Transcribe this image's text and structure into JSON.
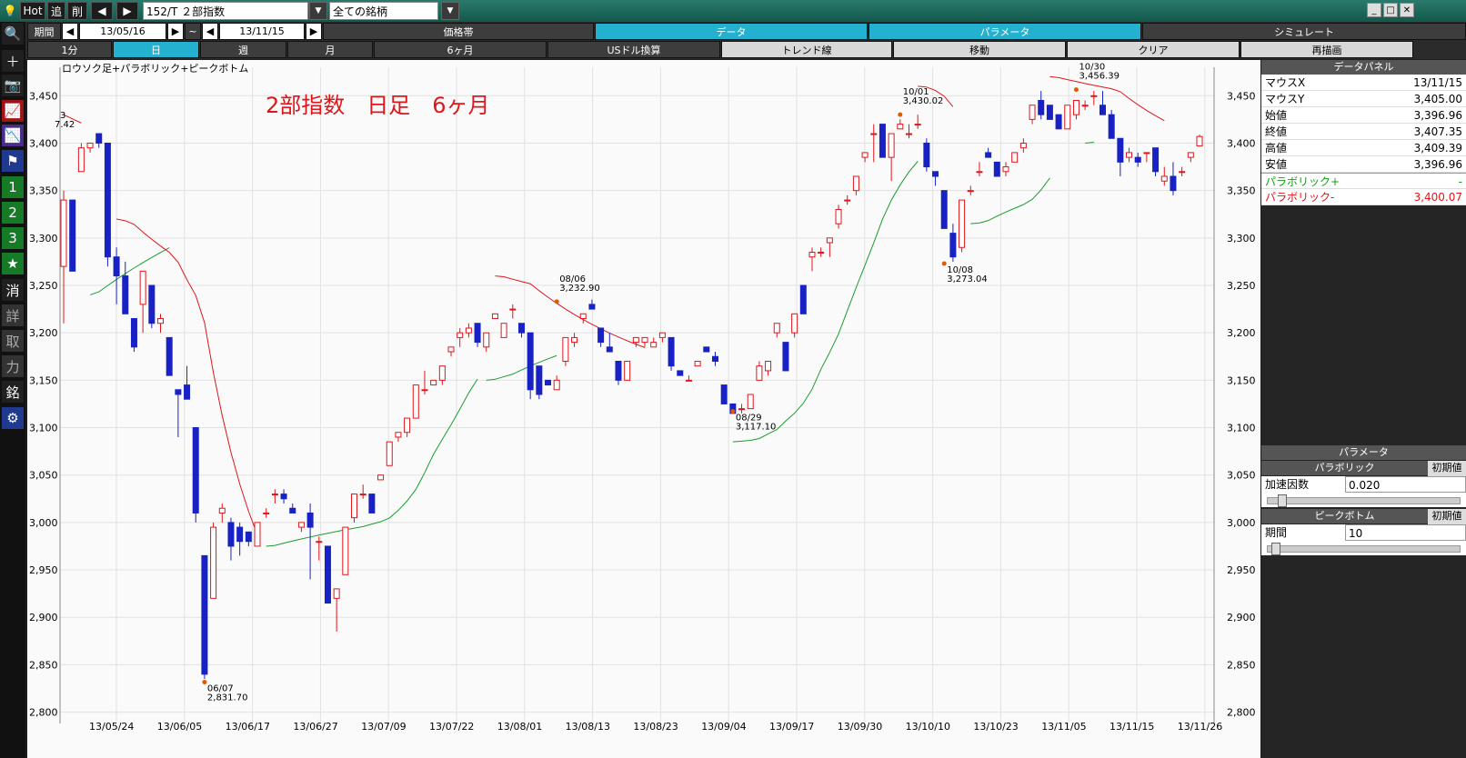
{
  "toolbar": {
    "hot": "Hot",
    "add": "追",
    "del": "削",
    "code": "152/T ２部指数",
    "filter": "全ての銘柄"
  },
  "period_row": {
    "label": "期間",
    "start": "13/05/16",
    "tilde": "~",
    "end": "13/11/15",
    "tabs": [
      "価格帯",
      "データ",
      "パラメータ",
      "シミュレート"
    ]
  },
  "timeframe_row": {
    "items": [
      "1分",
      "日",
      "週",
      "月",
      "6ヶ月",
      "USドル換算",
      "トレンド線",
      "移動",
      "クリア",
      "再描画"
    ]
  },
  "sidebar": {
    "items": [
      "search",
      "plus",
      "camera",
      "chart1",
      "chart2",
      "flag",
      "1",
      "2",
      "3",
      "★",
      "消",
      "詳",
      "取",
      "力",
      "銘",
      "gear"
    ]
  },
  "chart": {
    "indicator_label": "ロウソク足+パラボリック+ピークボトム",
    "title": "2部指数　日足　6ヶ月",
    "peak_labels": [
      {
        "date": "06/07",
        "value": "2,831.70"
      },
      {
        "date": "08/06",
        "value": "3,232.90"
      },
      {
        "date": "08/29",
        "value": "3,117.10"
      },
      {
        "date": "10/01",
        "value": "3,430.02"
      },
      {
        "date": "10/08",
        "value": "3,273.04"
      },
      {
        "date": "10/30",
        "value": "3,456.39"
      }
    ],
    "left_partial": [
      "3",
      "7.42"
    ]
  },
  "chart_data": {
    "type": "candlestick",
    "y_ticks": [
      "3,450",
      "3,400",
      "3,350",
      "3,300",
      "3,250",
      "3,200",
      "3,150",
      "3,100",
      "3,050",
      "3,000",
      "2,950",
      "2,900",
      "2,850",
      "2,800"
    ],
    "ylim": [
      2790,
      3480
    ],
    "x_ticks": [
      "13/05/24",
      "13/06/05",
      "13/06/17",
      "13/06/27",
      "13/07/09",
      "13/07/22",
      "13/08/01",
      "13/08/13",
      "13/08/23",
      "13/09/04",
      "13/09/17",
      "13/09/30",
      "13/10/10",
      "13/10/23",
      "13/11/05",
      "13/11/15",
      "13/11/26"
    ],
    "candles": [
      [
        3270,
        3350,
        3210,
        3340
      ],
      [
        3340,
        3340,
        3265,
        3265
      ],
      [
        3370,
        3400,
        3370,
        3395
      ],
      [
        3395,
        3400,
        3390,
        3400
      ],
      [
        3410,
        3410,
        3395,
        3400
      ],
      [
        3400,
        3400,
        3270,
        3280
      ],
      [
        3280,
        3290,
        3230,
        3260
      ],
      [
        3260,
        3275,
        3220,
        3220
      ],
      [
        3215,
        3215,
        3180,
        3185
      ],
      [
        3230,
        3265,
        3200,
        3265
      ],
      [
        3250,
        3250,
        3205,
        3210
      ],
      [
        3210,
        3220,
        3200,
        3215
      ],
      [
        3195,
        3195,
        3155,
        3155
      ],
      [
        3140,
        3140,
        3090,
        3135
      ],
      [
        3145,
        3165,
        3130,
        3130
      ],
      [
        3100,
        3100,
        3000,
        3010
      ],
      [
        2965,
        2965,
        2835,
        2840
      ],
      [
        2920,
        3000,
        2920,
        2995
      ],
      [
        3010,
        3020,
        3000,
        3015
      ],
      [
        3000,
        3005,
        2960,
        2975
      ],
      [
        2995,
        3000,
        2965,
        2980
      ],
      [
        2990,
        2990,
        2975,
        2980
      ],
      [
        2975,
        3000,
        2975,
        3000
      ],
      [
        3010,
        3015,
        3005,
        3010
      ],
      [
        3030,
        3035,
        3020,
        3030
      ],
      [
        3030,
        3035,
        3020,
        3025
      ],
      [
        3015,
        3020,
        3010,
        3010
      ],
      [
        2995,
        3000,
        2990,
        3000
      ],
      [
        3010,
        3020,
        2940,
        2995
      ],
      [
        2980,
        2985,
        2960,
        2980
      ],
      [
        2975,
        2975,
        2915,
        2915
      ],
      [
        2920,
        2930,
        2885,
        2930
      ],
      [
        2945,
        2995,
        2945,
        2995
      ],
      [
        3005,
        3020,
        3000,
        3030
      ],
      [
        3030,
        3040,
        3025,
        3030
      ],
      [
        3030,
        3030,
        3010,
        3010
      ],
      [
        3045,
        3050,
        3045,
        3050
      ],
      [
        3060,
        3085,
        3060,
        3085
      ],
      [
        3090,
        3095,
        3085,
        3095
      ],
      [
        3095,
        3110,
        3090,
        3110
      ],
      [
        3110,
        3145,
        3110,
        3145
      ],
      [
        3140,
        3160,
        3135,
        3140
      ],
      [
        3145,
        3150,
        3145,
        3150
      ],
      [
        3150,
        3165,
        3145,
        3165
      ],
      [
        3180,
        3185,
        3175,
        3185
      ],
      [
        3195,
        3205,
        3185,
        3200
      ],
      [
        3200,
        3210,
        3195,
        3205
      ],
      [
        3210,
        3210,
        3185,
        3190
      ],
      [
        3185,
        3200,
        3180,
        3200
      ],
      [
        3215,
        3220,
        3215,
        3220
      ],
      [
        3195,
        3210,
        3195,
        3210
      ],
      [
        3225,
        3230,
        3215,
        3225
      ],
      [
        3210,
        3210,
        3195,
        3200
      ],
      [
        3200,
        3195,
        3130,
        3140
      ],
      [
        3165,
        3165,
        3130,
        3135
      ],
      [
        3150,
        3150,
        3145,
        3145
      ],
      [
        3140,
        3155,
        3140,
        3150
      ],
      [
        3170,
        3195,
        3165,
        3195
      ],
      [
        3190,
        3200,
        3185,
        3195
      ],
      [
        3215,
        3220,
        3210,
        3220
      ],
      [
        3230,
        3235,
        3225,
        3225
      ],
      [
        3205,
        3205,
        3185,
        3190
      ],
      [
        3185,
        3200,
        3180,
        3180
      ],
      [
        3170,
        3170,
        3145,
        3150
      ],
      [
        3150,
        3170,
        3150,
        3170
      ],
      [
        3190,
        3195,
        3185,
        3195
      ],
      [
        3190,
        3195,
        3185,
        3195
      ],
      [
        3185,
        3195,
        3185,
        3190
      ],
      [
        3195,
        3200,
        3190,
        3200
      ],
      [
        3195,
        3195,
        3160,
        3165
      ],
      [
        3160,
        3160,
        3155,
        3155
      ],
      [
        3150,
        3155,
        3150,
        3150
      ],
      [
        3165,
        3170,
        3165,
        3170
      ],
      [
        3185,
        3185,
        3180,
        3180
      ],
      [
        3175,
        3180,
        3165,
        3170
      ],
      [
        3145,
        3145,
        3125,
        3125
      ],
      [
        3125,
        3125,
        3115,
        3115
      ],
      [
        3120,
        3125,
        3115,
        3120
      ],
      [
        3120,
        3135,
        3120,
        3135
      ],
      [
        3150,
        3170,
        3150,
        3165
      ],
      [
        3160,
        3170,
        3155,
        3170
      ],
      [
        3200,
        3210,
        3195,
        3210
      ],
      [
        3190,
        3190,
        3160,
        3160
      ],
      [
        3200,
        3220,
        3195,
        3220
      ],
      [
        3250,
        3250,
        3220,
        3220
      ],
      [
        3280,
        3290,
        3265,
        3285
      ],
      [
        3285,
        3290,
        3280,
        3285
      ],
      [
        3295,
        3300,
        3280,
        3300
      ],
      [
        3315,
        3335,
        3310,
        3330
      ],
      [
        3340,
        3345,
        3335,
        3340
      ],
      [
        3350,
        3365,
        3345,
        3365
      ],
      [
        3385,
        3390,
        3380,
        3390
      ],
      [
        3410,
        3420,
        3380,
        3410
      ],
      [
        3420,
        3420,
        3385,
        3385
      ],
      [
        3385,
        3410,
        3360,
        3410
      ],
      [
        3415,
        3425,
        3415,
        3420
      ],
      [
        3410,
        3420,
        3405,
        3410
      ],
      [
        3420,
        3430,
        3415,
        3420
      ],
      [
        3400,
        3405,
        3370,
        3375
      ],
      [
        3370,
        3370,
        3355,
        3365
      ],
      [
        3350,
        3350,
        3310,
        3310
      ],
      [
        3305,
        3315,
        3275,
        3280
      ],
      [
        3290,
        3340,
        3285,
        3340
      ],
      [
        3350,
        3355,
        3345,
        3350
      ],
      [
        3370,
        3380,
        3365,
        3370
      ],
      [
        3390,
        3395,
        3385,
        3385
      ],
      [
        3380,
        3380,
        3365,
        3365
      ],
      [
        3370,
        3380,
        3365,
        3375
      ],
      [
        3380,
        3390,
        3380,
        3390
      ],
      [
        3395,
        3405,
        3390,
        3400
      ],
      [
        3425,
        3440,
        3420,
        3440
      ],
      [
        3445,
        3455,
        3425,
        3430
      ],
      [
        3440,
        3440,
        3425,
        3425
      ],
      [
        3430,
        3430,
        3415,
        3415
      ],
      [
        3415,
        3440,
        3415,
        3440
      ],
      [
        3430,
        3445,
        3425,
        3445
      ],
      [
        3440,
        3445,
        3435,
        3440
      ],
      [
        3450,
        3455,
        3440,
        3450
      ],
      [
        3440,
        3455,
        3430,
        3430
      ],
      [
        3430,
        3435,
        3405,
        3405
      ],
      [
        3405,
        3405,
        3365,
        3380
      ],
      [
        3385,
        3395,
        3380,
        3390
      ],
      [
        3385,
        3390,
        3375,
        3380
      ],
      [
        3390,
        3390,
        3380,
        3390
      ],
      [
        3395,
        3395,
        3365,
        3370
      ],
      [
        3360,
        3375,
        3355,
        3365
      ],
      [
        3365,
        3380,
        3345,
        3350
      ],
      [
        3370,
        3375,
        3365,
        3370
      ],
      [
        3385,
        3390,
        3380,
        3390
      ],
      [
        3397,
        3409,
        3397,
        3407
      ]
    ],
    "parabolic_minus": [
      [
        0,
        3430
      ],
      [
        1,
        3420
      ],
      [
        2,
        3410
      ],
      [
        3,
        3405
      ],
      [
        4,
        3400
      ]
    ],
    "grid": true
  },
  "panel": {
    "data_header": "データパネル",
    "rows": [
      {
        "label": "マウスX",
        "value": "13/11/15"
      },
      {
        "label": "マウスY",
        "value": "3,405.00"
      },
      {
        "label": "始値",
        "value": "3,396.96"
      },
      {
        "label": "終値",
        "value": "3,407.35"
      },
      {
        "label": "高値",
        "value": "3,409.39"
      },
      {
        "label": "安値",
        "value": "3,396.96"
      }
    ],
    "para_plus": {
      "label": "パラボリック+",
      "value": "-"
    },
    "para_minus": {
      "label": "パラボリック-",
      "value": "3,400.07"
    },
    "param_header": "パラメータ",
    "parabolic": {
      "header": "パラボリック",
      "reset": "初期値",
      "label": "加速因数",
      "value": "0.020",
      "slider": 0.05
    },
    "peak": {
      "header": "ピークボトム",
      "reset": "初期値",
      "label": "期間",
      "value": "10",
      "slider": 0.02
    }
  },
  "colors": {
    "up": "#e0151a",
    "down": "#1822c4",
    "parabolic_up": "#1a9d2e",
    "parabolic_down": "#e0151a"
  }
}
